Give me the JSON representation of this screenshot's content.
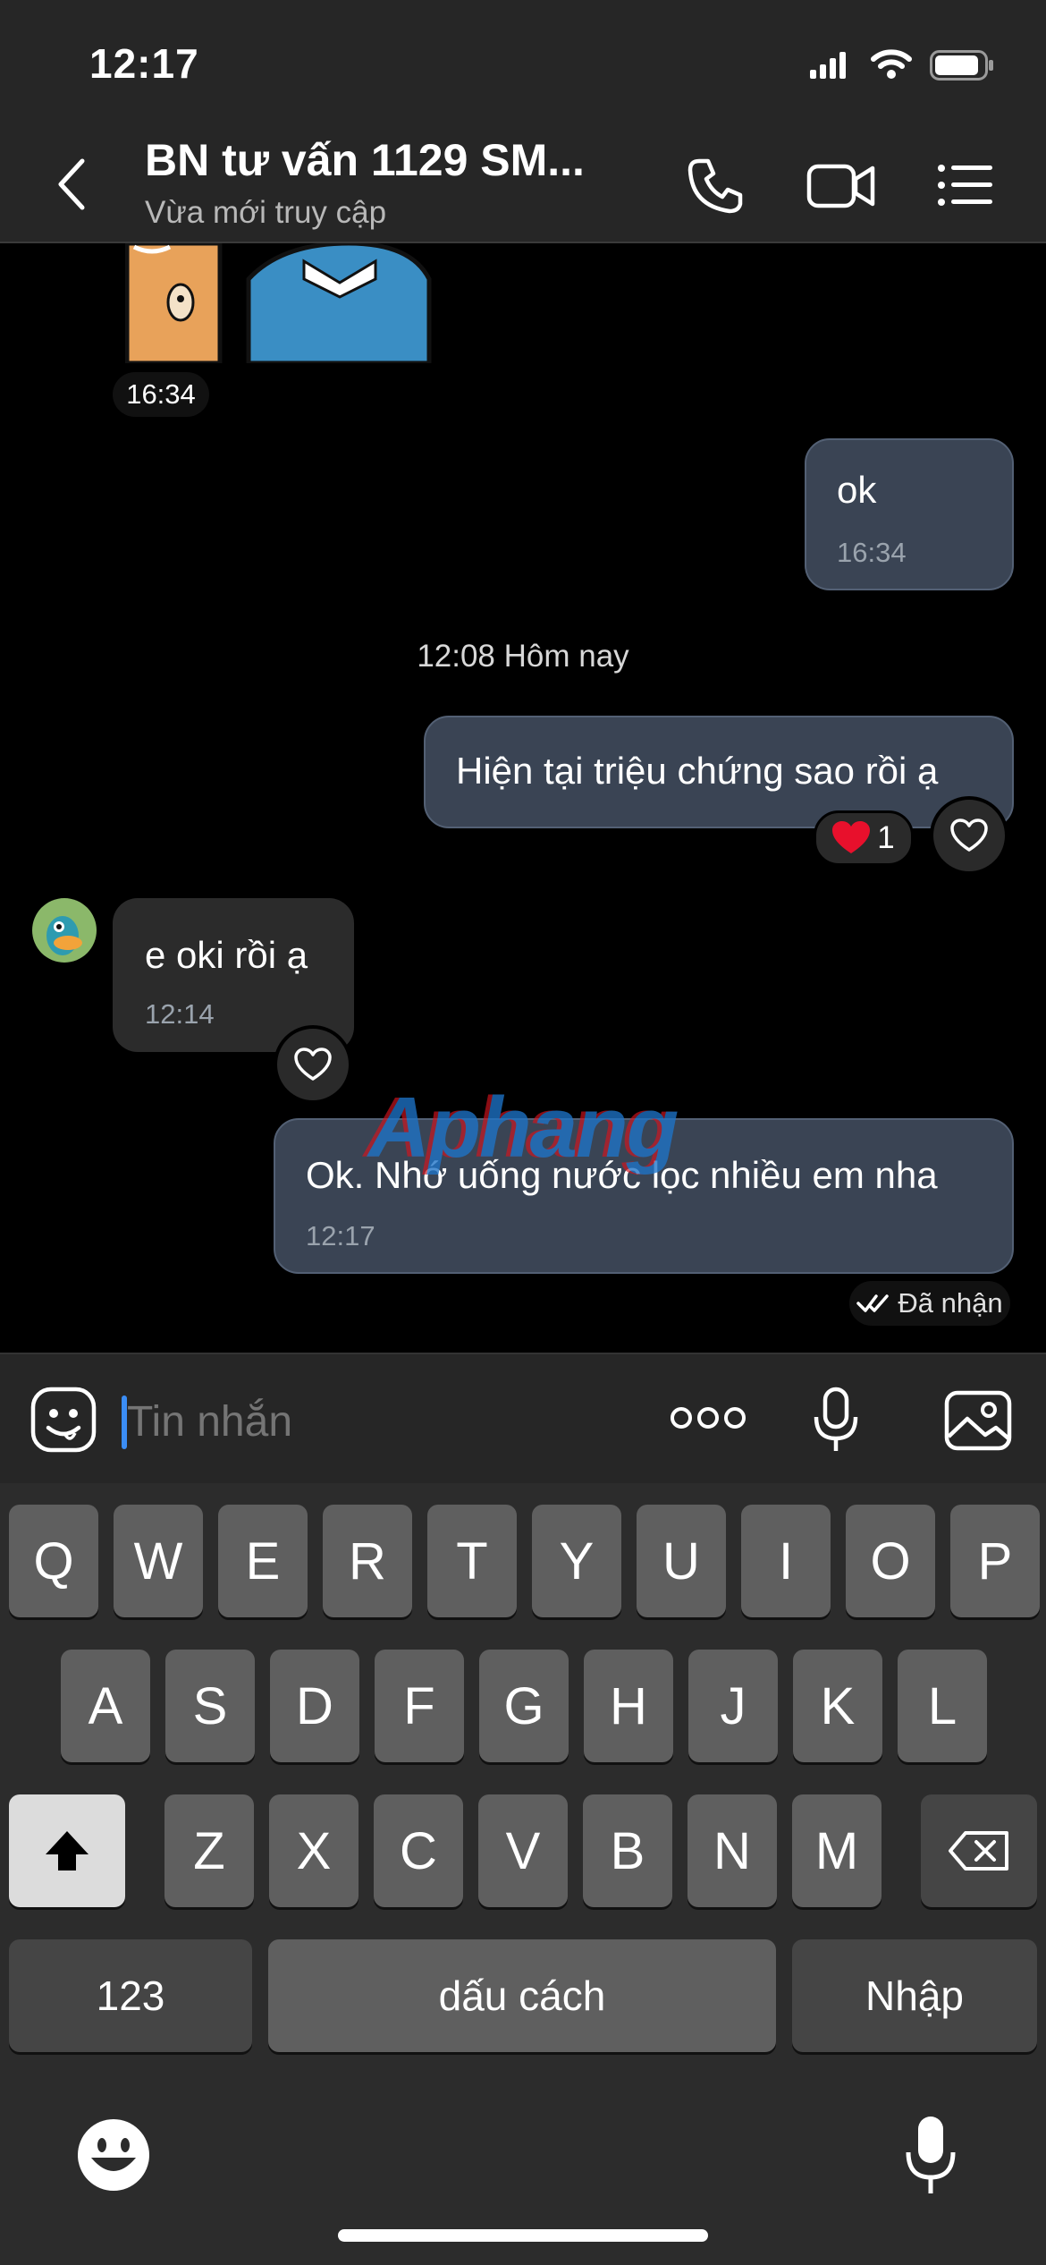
{
  "status_bar": {
    "time": "12:17"
  },
  "header": {
    "contact_name": "BN tư vấn 1129 SM...",
    "subtitle": "Vừa mới truy cập"
  },
  "messages": {
    "sticker_time": "16:34",
    "out1": {
      "text": "ok",
      "time": "16:34"
    },
    "date_separator": "12:08 Hôm nay",
    "out2": {
      "text": "Hiện tại triệu chứng sao rồi ạ",
      "reaction_count": "1"
    },
    "in1": {
      "text": "e oki rồi ạ",
      "time": "12:14"
    },
    "out3": {
      "text": "Ok. Nhớ uống nước lọc nhiều em nha",
      "time": "12:17",
      "status": "Đã nhận"
    }
  },
  "watermark": "Aphang",
  "input": {
    "placeholder": "Tin nhắn"
  },
  "keyboard": {
    "row1": [
      "Q",
      "W",
      "E",
      "R",
      "T",
      "Y",
      "U",
      "I",
      "O",
      "P"
    ],
    "row2": [
      "A",
      "S",
      "D",
      "F",
      "G",
      "H",
      "J",
      "K",
      "L"
    ],
    "row3": [
      "Z",
      "X",
      "C",
      "V",
      "B",
      "N",
      "M"
    ],
    "numbers_key": "123",
    "space_key": "dấu cách",
    "return_key": "Nhập"
  },
  "colors": {
    "outgoing_bubble": "#3a4454",
    "incoming_bubble": "#2b2b2b",
    "header_bg": "#262626",
    "heart": "#e8102c"
  }
}
